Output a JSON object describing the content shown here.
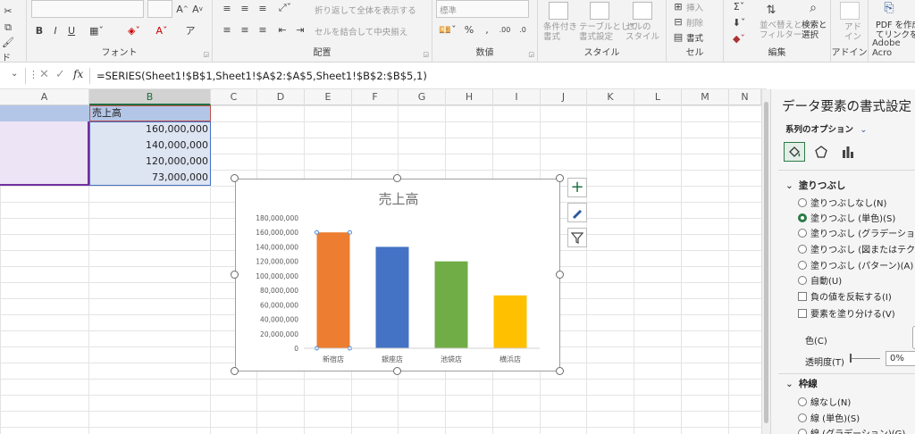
{
  "ribbon": {
    "groups": {
      "font": "フォント",
      "alignment": "配置",
      "number": "数値",
      "styles": "スタイル",
      "cells": "セル",
      "editing": "編集",
      "addins": "アドイン",
      "adobe": "Adobe Acro"
    },
    "wrap_text": "折り返して全体を表示する",
    "merge_center": "セルを結合して中央揃え",
    "number_format": "標準",
    "conditional_format": "条件付き\n書式",
    "table_format": "テーブルとして\n書式設定",
    "cell_styles": "セルの\nスタイル",
    "insert": "挿入",
    "delete": "削除",
    "format": "書式",
    "sort_filter": "並べ替えと\nフィルター",
    "find_select": "検索と\n選択",
    "addin_button": "アド\nイン",
    "pdf_create": "PDF を作成\nてリンクを共",
    "partial_left": "ド"
  },
  "formula_bar": {
    "fx": "fx",
    "formula": "=SERIES(Sheet1!$B$1,Sheet1!$A$2:$A$5,Sheet1!$B$2:$B$5,1)"
  },
  "columns": [
    "A",
    "B",
    "C",
    "D",
    "E",
    "F",
    "G",
    "H",
    "I",
    "J",
    "K",
    "L",
    "M",
    "N"
  ],
  "cells": {
    "b1": "売上高",
    "b2": "160,000,000",
    "b3": "140,000,000",
    "b4": "120,000,000",
    "b5": "73,000,000"
  },
  "chart_data": {
    "type": "bar",
    "title": "売上高",
    "categories": [
      "新宿店",
      "銀座店",
      "池袋店",
      "横浜店"
    ],
    "series": [
      {
        "values": [
          160000000,
          140000000,
          120000000,
          73000000
        ]
      }
    ],
    "bar_colors": [
      "#ed7d31",
      "#4472c4",
      "#70ad47",
      "#ffc000"
    ],
    "ylim": [
      0,
      180000000
    ],
    "ytick_labels": [
      "0",
      "20,000,000",
      "40,000,000",
      "60,000,000",
      "80,000,000",
      "100,000,000",
      "120,000,000",
      "140,000,000",
      "160,000,000",
      "180,000,000"
    ],
    "grid": false,
    "legend": "none"
  },
  "pane": {
    "title": "データ要素の書式設定",
    "series_options": "系列のオプション",
    "fill_section": "塗りつぶし",
    "fill_options": [
      "塗りつぶしなし(N)",
      "塗りつぶし (単色)(S)",
      "塗りつぶし (グラデーション)(G)",
      "塗りつぶし (図またはテクスチャ)(P",
      "塗りつぶし (パターン)(A)",
      "自動(U)"
    ],
    "selected_fill": 1,
    "invert_negative": "負の値を反転する(I)",
    "vary_colors": "要素を塗り分ける(V)",
    "color_label": "色(C)",
    "transparency_label": "透明度(T)",
    "transparency_value": "0%",
    "border_section": "枠線",
    "border_options": [
      "線なし(N)",
      "線 (単色)(S)",
      "線 (グラデーション)(G)"
    ]
  },
  "colors": {
    "accent_green": "#1e7145",
    "header_fill": "#b4c6e7",
    "data_fill": "#dde4f2"
  }
}
